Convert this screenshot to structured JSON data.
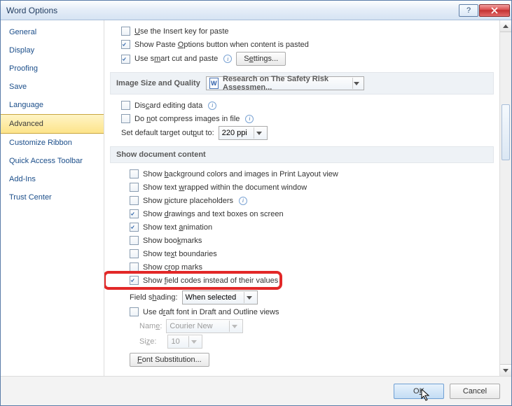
{
  "window": {
    "title": "Word Options"
  },
  "sidebar": {
    "items": [
      {
        "label": "General"
      },
      {
        "label": "Display"
      },
      {
        "label": "Proofing"
      },
      {
        "label": "Save"
      },
      {
        "label": "Language"
      },
      {
        "label": "Advanced",
        "selected": true
      },
      {
        "label": "Customize Ribbon"
      },
      {
        "label": "Quick Access Toolbar"
      },
      {
        "label": "Add-Ins"
      },
      {
        "label": "Trust Center"
      }
    ]
  },
  "top": {
    "use_insert_key": "Use the Insert key for paste",
    "show_paste_opts": "Show Paste Options button when content is pasted",
    "use_smart_cut": "Use smart cut and paste",
    "settings_btn": "Settings..."
  },
  "img_section": {
    "title": "Image Size and Quality",
    "doc_select": "Research on The Safety Risk Assessmen...",
    "discard": "Discard editing data",
    "no_compress": "Do not compress images in file",
    "default_target_label": "Set default target output to:",
    "default_target_value": "220 ppi"
  },
  "doc_section": {
    "title": "Show document content",
    "opts": {
      "bg_colors": "Show background colors and images in Print Layout view",
      "text_wrapped": "Show text wrapped within the document window",
      "pic_placeholders": "Show picture placeholders",
      "drawings": "Show drawings and text boxes on screen",
      "text_anim": "Show text animation",
      "bookmarks": "Show bookmarks",
      "text_bound": "Show text boundaries",
      "crop_marks": "Show crop marks",
      "field_codes": "Show field codes instead of their values"
    },
    "field_shading_label": "Field shading:",
    "field_shading_value": "When selected",
    "draft_font": "Use draft font in Draft and Outline views",
    "name_label": "Name:",
    "name_value": "Courier New",
    "size_label": "Size:",
    "size_value": "10",
    "font_sub_btn": "Font Substitution..."
  },
  "footer": {
    "ok": "OK",
    "cancel": "Cancel"
  }
}
